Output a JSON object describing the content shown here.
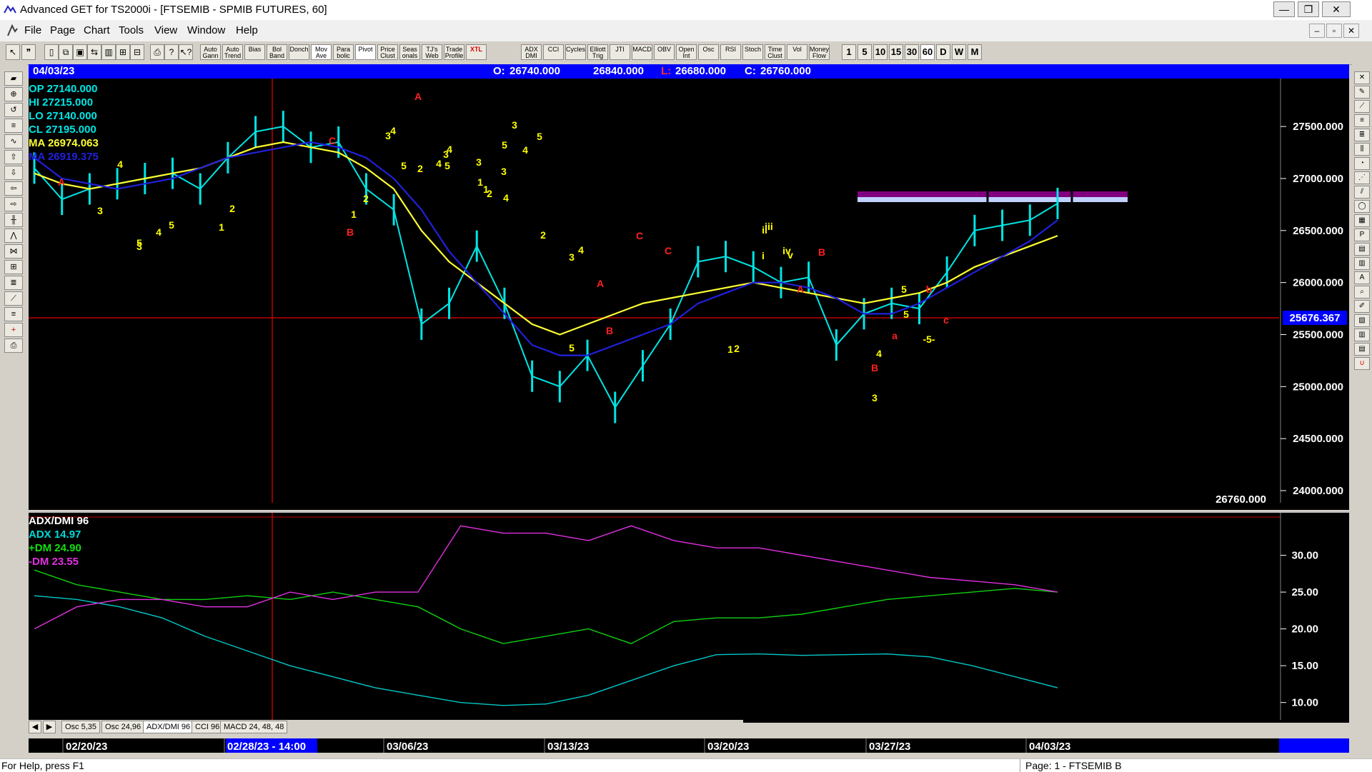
{
  "window": {
    "title": "Advanced GET for TS2000i - [FTSEMIB - SPMIB FUTURES, 60]",
    "controls": {
      "minimize": "—",
      "maximize": "❐",
      "close": "✕"
    }
  },
  "menu": {
    "items": [
      "File",
      "Page",
      "Chart",
      "Tools",
      "View",
      "Window",
      "Help"
    ],
    "mdi_controls": [
      "–",
      "▫",
      "✕"
    ]
  },
  "toolbar": {
    "study_buttons": [
      "Auto Gann",
      "Auto Trend",
      "Bias",
      "Bol Band",
      "Donch",
      "Mov Ave",
      "Para bolic",
      "Pivot",
      "Price Clust",
      "Seas onals",
      "TJ's Web",
      "Trade Profile",
      "XTL",
      "ADX DMI",
      "CCI",
      "Cycles",
      "Elliott Trig",
      "JTI",
      "MACD",
      "OBV",
      "Open Int",
      "Osc",
      "RSI",
      "Stoch",
      "Time Clust",
      "Vol",
      "Money Flow"
    ],
    "intervals": [
      "1",
      "5",
      "10",
      "15",
      "30",
      "60",
      "D",
      "W",
      "M"
    ],
    "active_interval": "60"
  },
  "header": {
    "date": "04/03/23",
    "open_label": "O:",
    "open": "26740.000",
    "high": "26840.000",
    "low_label": "L:",
    "low": "26680.000",
    "close_label": "C:",
    "close": "26760.000"
  },
  "legend": {
    "op": "OP  27140.000",
    "hi": "HI   27215.000",
    "lo": "LO  27140.000",
    "cl": "CL  27195.000",
    "ma1": "MA  26974.063",
    "ma2": "MA  26919.375"
  },
  "colors": {
    "price": "#00e5e5",
    "ma_fast": "#ffff33",
    "ma_slow": "#2020dd",
    "wave_yellow": "#ffff00",
    "wave_red": "#ff2020",
    "adx": "#00c8c8",
    "plus_dm": "#10d010",
    "minus_dm": "#e030e0",
    "highlight": "#0000ff"
  },
  "price_axis": {
    "ticks": [
      "27500.000",
      "27000.000",
      "26500.000",
      "26000.000",
      "25500.000",
      "25000.000",
      "24500.000",
      "24000.000"
    ],
    "current": "25676.367",
    "last_close": "26760.000"
  },
  "indicator": {
    "title": "ADX/DMI 96",
    "adx": "ADX 14.97",
    "plus_dm": "+DM 24.90",
    "minus_dm": "-DM  23.55",
    "ticks": [
      "30.00",
      "25.00",
      "20.00",
      "15.00",
      "10.00"
    ]
  },
  "chart_data": {
    "type": "line",
    "ylim": [
      24000,
      27700
    ],
    "x": [
      "02/20/23",
      "02/28/23 - 14:00",
      "03/06/23",
      "03/13/23",
      "03/20/23",
      "03/27/23",
      "04/03/23"
    ],
    "series": [
      {
        "values": [
          27100,
          26800,
          26900,
          26950,
          27000,
          27050,
          26900,
          27200,
          27450,
          27500,
          27300,
          27350,
          26900,
          26700,
          25600,
          25800,
          26350,
          25800,
          25100,
          25000,
          25300,
          24800,
          25200,
          25600,
          26200,
          26250,
          26150,
          26000,
          26050,
          25400,
          25700,
          25800,
          25750,
          26100,
          26500,
          26550,
          26600,
          26760
        ]
      },
      {
        "values": [
          27050,
          26950,
          26900,
          26950,
          27000,
          27050,
          27100,
          27200,
          27300,
          27350,
          27300,
          27250,
          27100,
          26900,
          26500,
          26200,
          26000,
          25800,
          25600,
          25500,
          25600,
          25700,
          25800,
          25850,
          25900,
          25950,
          26000,
          25950,
          25900,
          25850,
          25800,
          25850,
          25900,
          26000,
          26150,
          26250,
          26350,
          26450
        ]
      },
      {
        "values": [
          27200,
          27000,
          26950,
          26900,
          26950,
          27000,
          27100,
          27200,
          27250,
          27300,
          27350,
          27300,
          27200,
          27000,
          26700,
          26300,
          26000,
          25700,
          25400,
          25300,
          25300,
          25400,
          25500,
          25600,
          25800,
          25900,
          26000,
          26000,
          25950,
          25850,
          25700,
          25700,
          25800,
          25950,
          26100,
          26250,
          26400,
          26600
        ]
      }
    ]
  },
  "indicator_data": {
    "type": "line",
    "ylim": [
      9,
      35
    ],
    "series": [
      {
        "values": [
          24.5,
          24,
          23,
          21.5,
          19,
          17,
          15,
          13.5,
          12,
          11,
          10,
          9.6,
          9.8,
          11,
          13,
          15,
          16.5,
          16.6,
          16.4,
          16.5,
          16.6,
          16.2,
          15,
          13.5,
          12
        ]
      },
      {
        "values": [
          28,
          26,
          25,
          24,
          24,
          24.5,
          24,
          25,
          24,
          23,
          20,
          18,
          19,
          20,
          18,
          21,
          21.5,
          21.5,
          22,
          23,
          24,
          24.5,
          25,
          25.5,
          25
        ]
      },
      {
        "values": [
          20,
          23,
          24,
          24,
          23,
          23,
          25,
          24,
          25,
          25,
          34,
          33,
          33,
          32,
          34,
          32,
          31,
          31,
          30,
          29,
          28,
          27,
          26.5,
          26,
          25
        ]
      }
    ]
  },
  "time_axis": {
    "labels": [
      "02/20/23",
      "02/28/23 - 14:00",
      "03/06/23",
      "03/13/23",
      "03/20/23",
      "03/27/23",
      "04/03/23"
    ]
  },
  "panel_tabs": [
    "Osc 5,35",
    "Osc 24,96",
    "ADX/DMI 96",
    "CCI 96",
    "MACD 24, 48, 48"
  ],
  "active_panel_tab": "ADX/DMI 96",
  "status": {
    "left": "For Help, press F1",
    "right": "Page: 1 - FTSEMIB B"
  },
  "waves": {
    "yellow": [
      "3",
      "4",
      "5",
      "3",
      "4",
      "5",
      "1",
      "2",
      "1",
      "2",
      "3",
      "4",
      "5",
      "2",
      "4",
      "3",
      "4",
      "5",
      "3",
      "1",
      "2",
      "5",
      "4",
      "3",
      "4",
      "5",
      "3",
      "1",
      "2",
      "3",
      "4",
      "5",
      "1",
      "2",
      "i",
      "ii",
      "iii",
      "iv",
      "v",
      "3",
      "4",
      "5",
      "5",
      "-5-"
    ],
    "red": [
      "A",
      "C",
      "A",
      "B",
      "C",
      "A",
      "B",
      "C",
      "A",
      "B",
      "B",
      "a",
      "b",
      "c"
    ]
  }
}
